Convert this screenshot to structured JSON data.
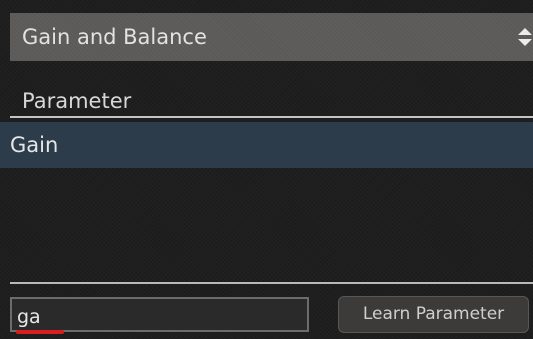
{
  "preset_selector": {
    "value": "Gain and Balance",
    "icon": "chevron-updown-icon"
  },
  "parameter_list": {
    "header": "Parameter",
    "items": [
      {
        "label": "Gain",
        "selected": true
      }
    ]
  },
  "search": {
    "value": "ga"
  },
  "learn_button": {
    "label": "Learn Parameter"
  },
  "colors": {
    "panel_background": "#1f1e1e",
    "selector_background": "#5c5a59",
    "selected_row": "#2c3c4a",
    "spellcheck_underline": "#d81e1e"
  }
}
